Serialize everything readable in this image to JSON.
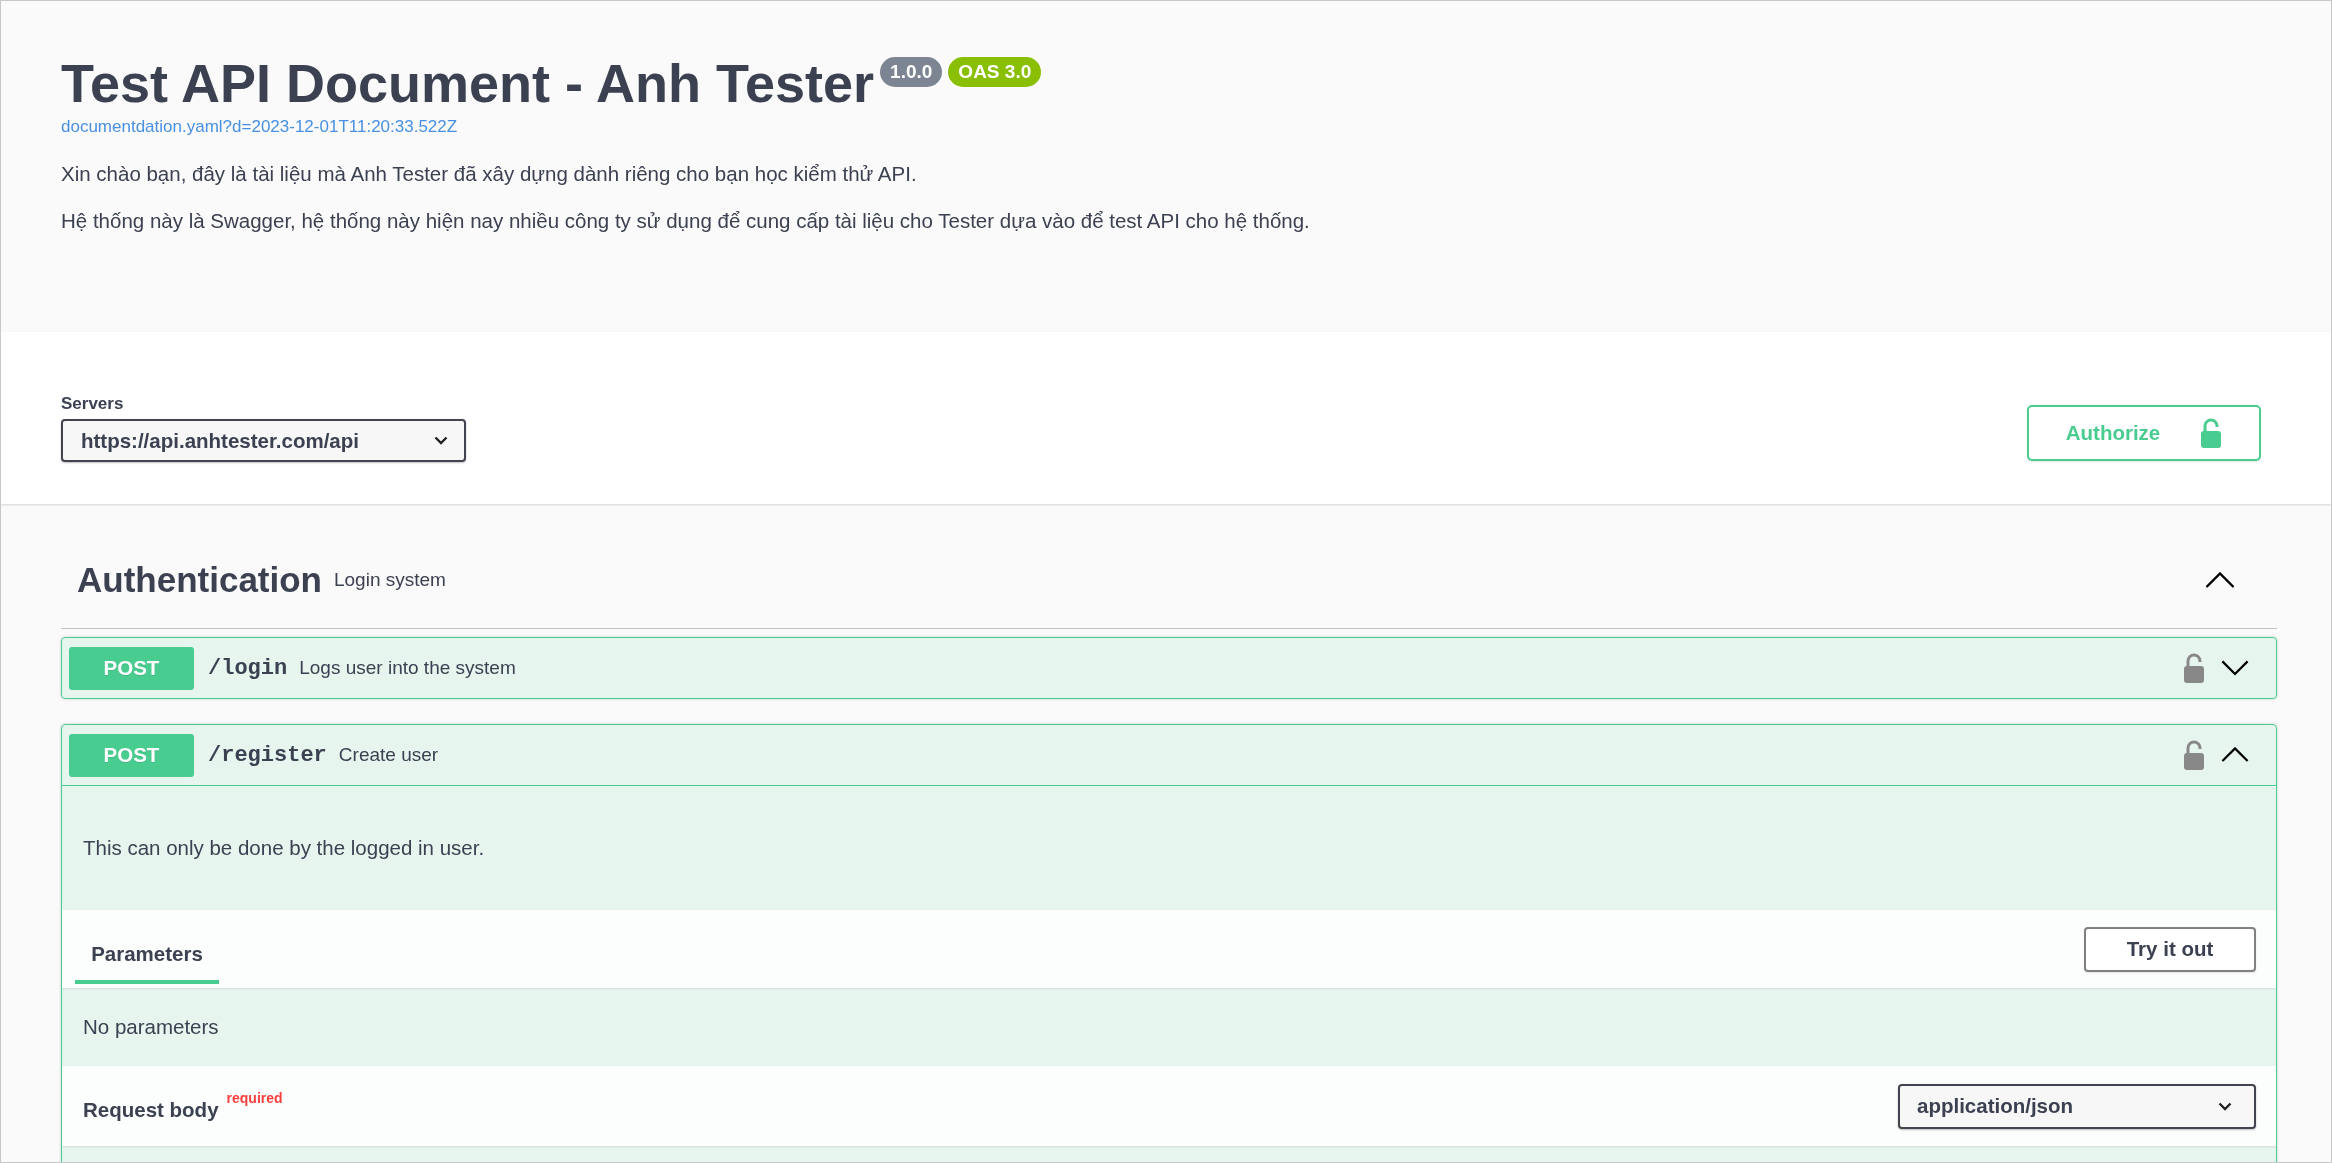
{
  "info": {
    "title": "Test API Document - Anh Tester",
    "version": "1.0.0",
    "oas": "OAS 3.0",
    "url": "documentdation.yaml?d=2023-12-01T11:20:33.522Z",
    "description": [
      "Xin chào bạn, đây là tài liệu mà Anh Tester đã xây dựng dành riêng cho bạn học kiểm thử API.",
      "Hệ thống này là Swagger, hệ thống này hiện nay nhiều công ty sử dụng để cung cấp tài liệu cho Tester dựa vào để test API cho hệ thống."
    ]
  },
  "servers": {
    "label": "Servers",
    "selected": "https://api.anhtester.com/api"
  },
  "authorize": {
    "label": "Authorize",
    "locked": false
  },
  "tags": [
    {
      "name": "Authentication",
      "description": "Login system",
      "expanded": true,
      "operations": [
        {
          "method": "POST",
          "path": "/login",
          "summary": "Logs user into the system",
          "locked": false,
          "expanded": false
        },
        {
          "method": "POST",
          "path": "/register",
          "summary": "Create user",
          "locked": false,
          "expanded": true,
          "description": "This can only be done by the logged in user.",
          "tabs": [
            {
              "label": "Parameters",
              "selected": true
            }
          ],
          "try_button": "Try it out",
          "parameters_message": "No parameters",
          "request_body": {
            "label": "Request body",
            "required": "required",
            "content_type": "application/json"
          }
        }
      ]
    }
  ]
}
